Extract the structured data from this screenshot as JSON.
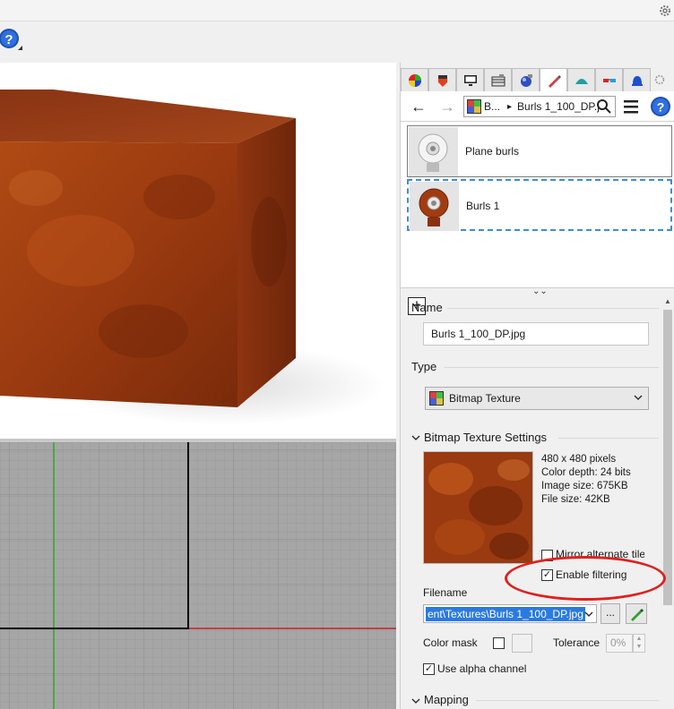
{
  "colors": {
    "accent": "#3a8fd8",
    "highlight_ellipse": "#e0201c",
    "wood": "#9a3b10",
    "grid_bg": "#a6a6a6"
  },
  "toolbar": {
    "help_icon": "help-icon"
  },
  "panel": {
    "tabs": [
      "color-wheel-icon",
      "materials-icon",
      "display-icon",
      "layers-icon",
      "environment-icon",
      "texture-icon",
      "rendering-icon",
      "glasses-icon",
      "notifications-icon",
      "gear-icon"
    ],
    "nav": {
      "back": "←",
      "forward": "→",
      "breadcrumb_root": "B...",
      "breadcrumb_sep": "▸",
      "breadcrumb_current": "Burls 1_100_DP.j"
    },
    "materials": [
      {
        "name": "Plane burls",
        "selected": false
      },
      {
        "name": "Burls 1",
        "selected": true
      }
    ],
    "add_label": "+",
    "collapse": "⌄⌄"
  },
  "props": {
    "name_label": "Name",
    "name_value": "Burls 1_100_DP.jpg",
    "type_label": "Type",
    "type_value": "Bitmap Texture",
    "bitmap_section": "Bitmap Texture Settings",
    "info": {
      "dimensions": "480 x 480 pixels",
      "depth": "Color depth: 24 bits",
      "image_size": "Image size: 675KB",
      "file_size": "File size: 42KB"
    },
    "mirror_label": "Mirror alternate tile",
    "filtering_label": "Enable filtering",
    "filtering_checked": true,
    "filename_label": "Filename",
    "filename_value": "ent\\Textures\\Burls 1_100_DP.jpg",
    "browse_label": "...",
    "color_mask_label": "Color mask",
    "tolerance_label": "Tolerance",
    "tolerance_value": "0%",
    "alpha_label": "Use alpha channel",
    "alpha_checked": true,
    "mapping_section": "Mapping"
  }
}
